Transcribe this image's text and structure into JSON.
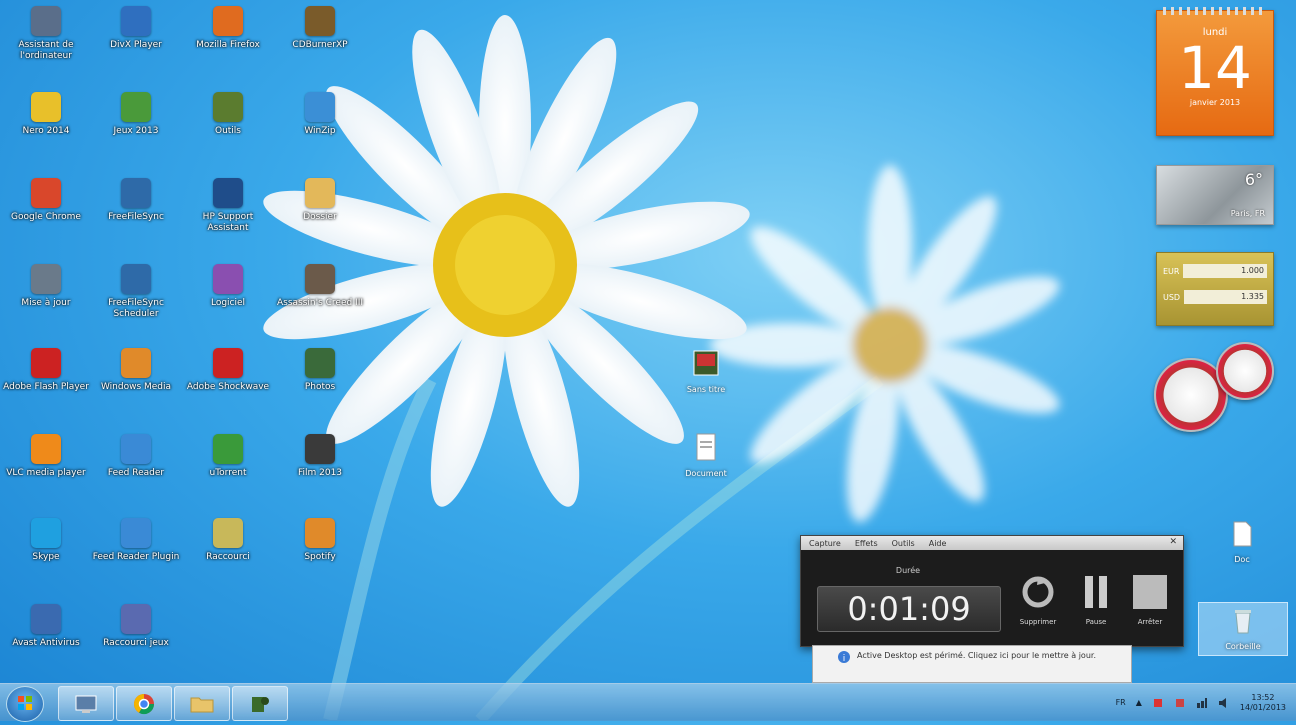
{
  "desktop_icons": [
    {
      "label": "Assistant de l'ordinateur",
      "color": "#5a6e8a",
      "icon": "computer-icon"
    },
    {
      "label": "DivX Player",
      "color": "#2f6fbf",
      "icon": "divx-icon"
    },
    {
      "label": "Mozilla Firefox",
      "color": "#e06b1f",
      "icon": "firefox-icon"
    },
    {
      "label": "CDBurnerXP",
      "color": "#7a5b2a",
      "icon": "burner-icon"
    },
    {
      "label": "Nero 2014",
      "color": "#e8c02a",
      "icon": "nero-icon"
    },
    {
      "label": "Jeux 2013",
      "color": "#4a9a3a",
      "icon": "games-icon"
    },
    {
      "label": "Outils",
      "color": "#5b7c2f",
      "icon": "tools-icon"
    },
    {
      "label": "WinZip",
      "color": "#3b8fd6",
      "icon": "winzip-icon"
    },
    {
      "label": "Google Chrome",
      "color": "#d9472b",
      "icon": "chrome-icon"
    },
    {
      "label": "FreeFileSync",
      "color": "#2e6aa8",
      "icon": "sync-icon"
    },
    {
      "label": "HP Support Assistant",
      "color": "#1f4d8a",
      "icon": "help-icon"
    },
    {
      "label": "Dossier",
      "color": "#e3b85a",
      "icon": "folder-icon"
    },
    {
      "label": "Mise à jour",
      "color": "#6a7a8a",
      "icon": "update-icon"
    },
    {
      "label": "FreeFileSync Scheduler",
      "color": "#2e6aa8",
      "icon": "scheduler-icon"
    },
    {
      "label": "Logiciel",
      "color": "#8a4fb0",
      "icon": "software-icon"
    },
    {
      "label": "Assassin's Creed III",
      "color": "#6b5a4a",
      "icon": "game-icon"
    },
    {
      "label": "Adobe Flash Player",
      "color": "#cc2222",
      "icon": "flash-icon"
    },
    {
      "label": "Windows Media",
      "color": "#e08a2a",
      "icon": "media-icon"
    },
    {
      "label": "Adobe Shockwave",
      "color": "#cc2222",
      "icon": "shockwave-icon"
    },
    {
      "label": "Photos",
      "color": "#3a6a3a",
      "icon": "photo-icon"
    },
    {
      "label": "VLC media player",
      "color": "#ef8a1a",
      "icon": "vlc-icon"
    },
    {
      "label": "Feed Reader",
      "color": "#3a8ad6",
      "icon": "feed-icon"
    },
    {
      "label": "uTorrent",
      "color": "#3a9a3a",
      "icon": "torrent-icon"
    },
    {
      "label": "Film 2013",
      "color": "#3a3a3a",
      "icon": "film-icon"
    },
    {
      "label": "Skype",
      "color": "#1fa0e0",
      "icon": "skype-icon"
    },
    {
      "label": "Feed Reader Plugin",
      "color": "#3a8ad6",
      "icon": "plugin-icon"
    },
    {
      "label": "Raccourci",
      "color": "#c8b85a",
      "icon": "shortcut-icon"
    },
    {
      "label": "Spotify",
      "color": "#e08a2a",
      "icon": "spotify-icon"
    },
    {
      "label": "Avast Antivirus",
      "color": "#3a6ab0",
      "icon": "avast-icon"
    },
    {
      "label": "Raccourci jeux",
      "color": "#5a6ab0",
      "icon": "shortcut2-icon"
    }
  ],
  "calendar": {
    "day_name": "lundi",
    "day": "14",
    "month_year": "janvier 2013"
  },
  "weather": {
    "temp": "6°",
    "city": "Paris, FR"
  },
  "currency": {
    "rows": [
      {
        "code": "EUR",
        "value": "1.000"
      },
      {
        "code": "USD",
        "value": "1.335"
      }
    ]
  },
  "recorder": {
    "menu": [
      "Capture",
      "Effets",
      "Outils",
      "Aide"
    ],
    "duration_label": "Durée",
    "time": "0:01:09",
    "buttons": [
      {
        "label": "Supprimer",
        "icon": "delete-icon"
      },
      {
        "label": "Pause",
        "icon": "pause-icon"
      },
      {
        "label": "Arrêter",
        "icon": "stop-icon"
      }
    ]
  },
  "notification": {
    "text": "Active Desktop est périmé. Cliquez ici pour le mettre à jour."
  },
  "desktop_files": [
    {
      "label": "Sans titre",
      "icon": "photo-file-icon"
    },
    {
      "label": "Document",
      "icon": "text-file-icon"
    }
  ],
  "right_items": [
    {
      "label": "Doc",
      "icon": "document-icon"
    },
    {
      "label": "Corbeille",
      "icon": "recycle-bin-icon"
    }
  ],
  "taskbar": {
    "apps": [
      {
        "name": "Explorateur",
        "icon": "explorer-icon"
      },
      {
        "name": "Chrome",
        "icon": "chrome-taskbar-icon"
      },
      {
        "name": "Dossiers",
        "icon": "folders-icon"
      },
      {
        "name": "Enregistreur",
        "icon": "recorder-icon"
      }
    ],
    "lang": "FR",
    "time": "13:52",
    "date": "14/01/2013"
  }
}
